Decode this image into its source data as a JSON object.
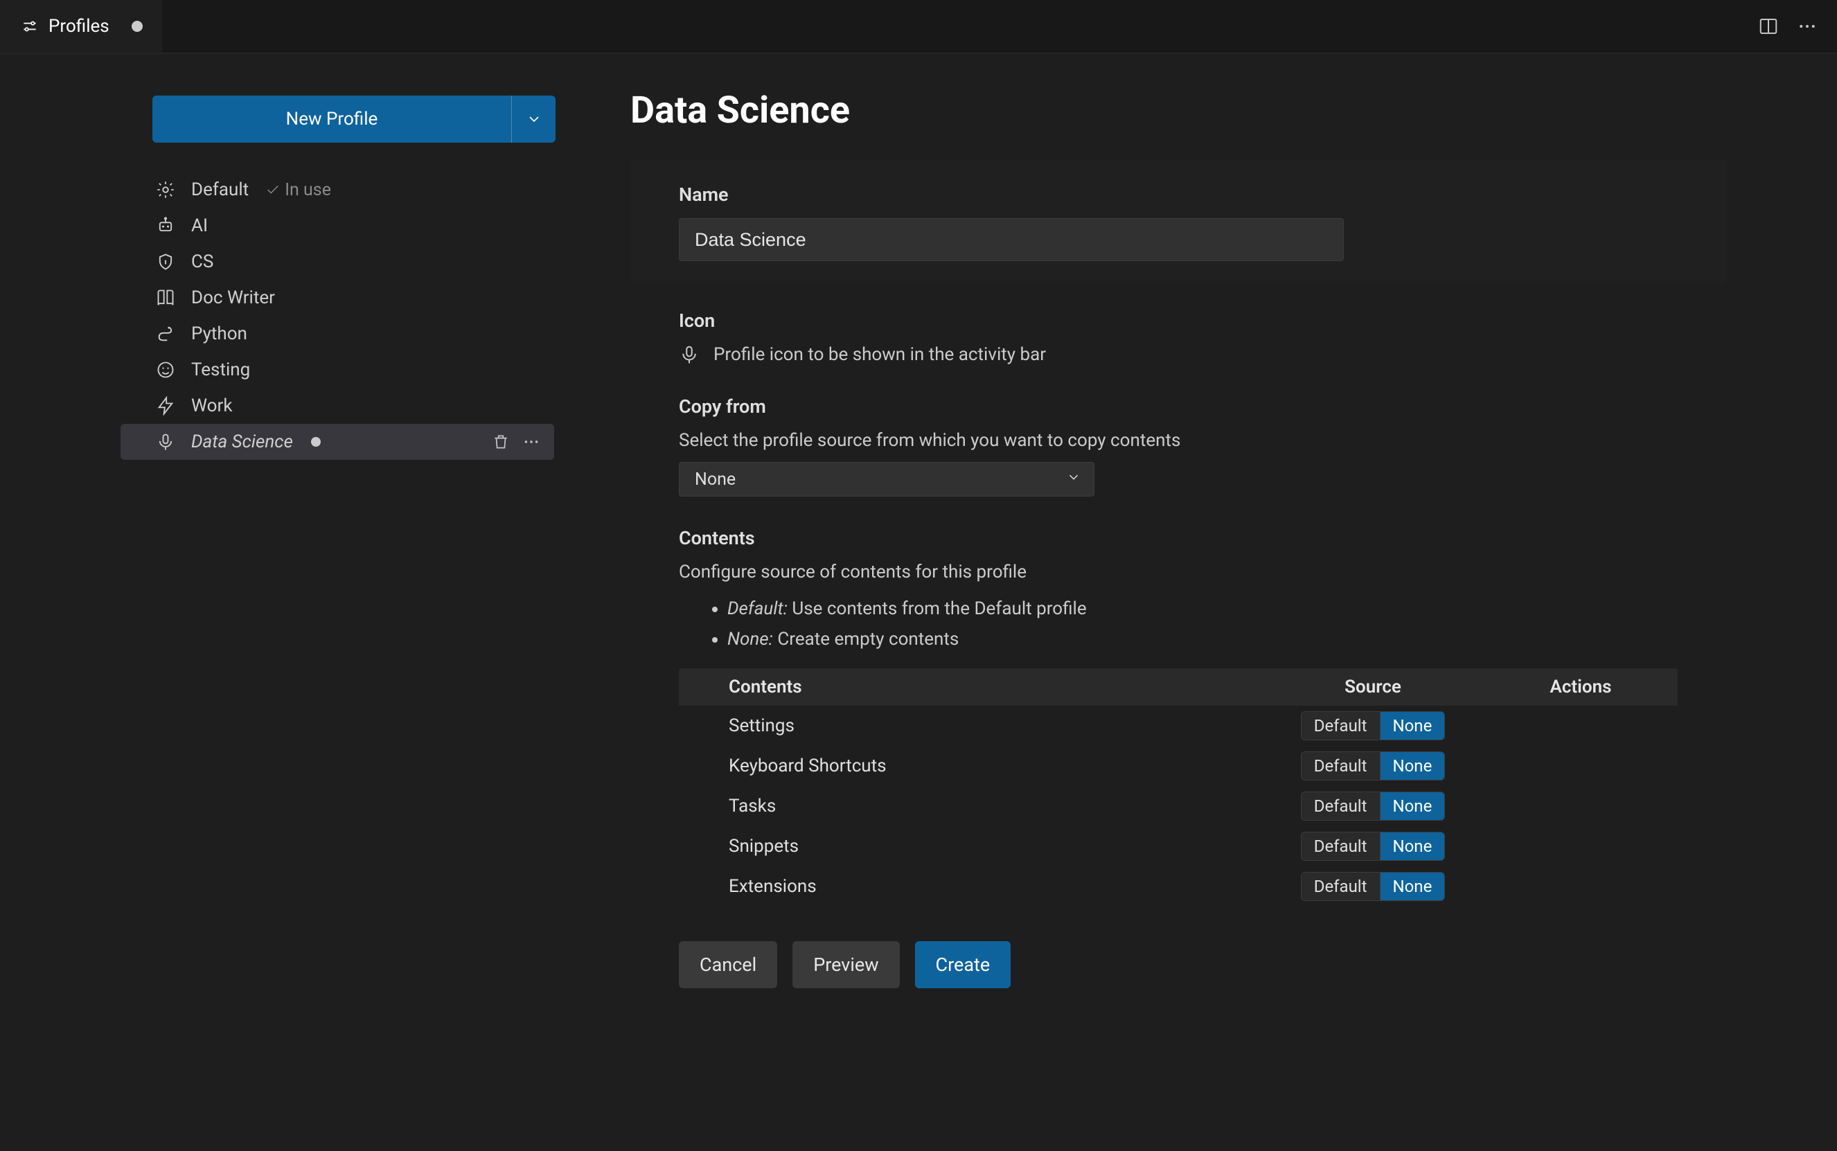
{
  "tab": {
    "title": "Profiles"
  },
  "sidebar": {
    "newProfile": "New Profile",
    "items": [
      {
        "name": "Default",
        "icon": "gear",
        "inUse": "In use"
      },
      {
        "name": "AI",
        "icon": "robot"
      },
      {
        "name": "CS",
        "icon": "shield"
      },
      {
        "name": "Doc Writer",
        "icon": "book"
      },
      {
        "name": "Python",
        "icon": "snake"
      },
      {
        "name": "Testing",
        "icon": "smile"
      },
      {
        "name": "Work",
        "icon": "zap"
      },
      {
        "name": "Data Science",
        "icon": "mic",
        "selected": true,
        "dirty": true
      }
    ]
  },
  "main": {
    "title": "Data Science",
    "name": {
      "label": "Name",
      "value": "Data Science"
    },
    "icon": {
      "label": "Icon",
      "desc": "Profile icon to be shown in the activity bar"
    },
    "copyFrom": {
      "label": "Copy from",
      "desc": "Select the profile source from which you want to copy contents",
      "value": "None"
    },
    "contents": {
      "label": "Contents",
      "desc": "Configure source of contents for this profile",
      "bullet1Em": "Default:",
      "bullet1": " Use contents from the Default profile",
      "bullet2Em": "None:",
      "bullet2": " Create empty contents",
      "headers": {
        "c1": "Contents",
        "c2": "Source",
        "c3": "Actions"
      },
      "segDefault": "Default",
      "segNone": "None",
      "rows": [
        {
          "name": "Settings",
          "source": "None"
        },
        {
          "name": "Keyboard Shortcuts",
          "source": "None"
        },
        {
          "name": "Tasks",
          "source": "None"
        },
        {
          "name": "Snippets",
          "source": "None"
        },
        {
          "name": "Extensions",
          "source": "None"
        }
      ]
    },
    "actions": {
      "cancel": "Cancel",
      "preview": "Preview",
      "create": "Create"
    }
  }
}
